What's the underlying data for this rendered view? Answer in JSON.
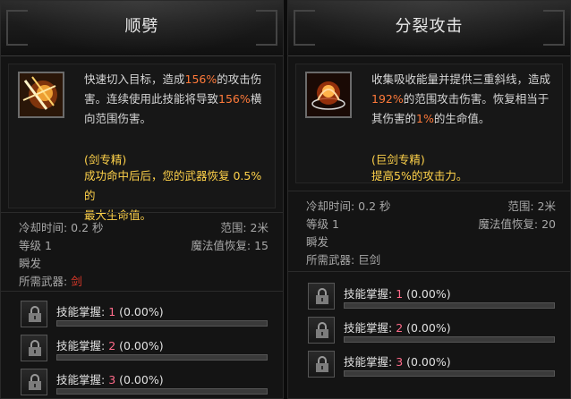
{
  "left": {
    "title": "顺劈",
    "desc_line1_pre": "快速切入目标，造成",
    "desc_line1_pct": "156%",
    "desc_line1_post": "的攻击伤",
    "desc_line2_pre": "害。连续使用此技能将导致",
    "desc_line2_pct": "156%",
    "desc_line2_post": "横",
    "desc_line3": "向范围伤害。",
    "spec_title": "(剑专精)",
    "spec_line1": "成功命中后后，您的武器恢复 0.5% 的",
    "spec_line2": "最大生命值。",
    "cooldown": "冷却时间: 0.2 秒",
    "range": "范围: 2米",
    "level": "等级 1",
    "mana": "魔法值恢复: 15",
    "cast": "瞬发",
    "weapon_label": "所需武器: ",
    "weapon_value": "剑"
  },
  "right": {
    "title": "分裂攻击",
    "desc_line1": "收集吸收能量并提供三重斜线，造成",
    "desc_line2_pct": "192%",
    "desc_line2_post": "的范围攻击伤害。恢复相当于",
    "desc_line3_pre": "其伤害的",
    "desc_line3_pct": "1%",
    "desc_line3_post": "的生命值。",
    "spec_title": "(巨剑专精)",
    "spec_line1": "提高5%的攻击力。",
    "cooldown": "冷却时间: 0.2 秒",
    "range": "范围: 2米",
    "level": "等级 1",
    "mana": "魔法值恢复: 20",
    "cast": "瞬发",
    "weapon": "所需武器: 巨剑"
  },
  "mastery": {
    "label": "技能掌握: ",
    "rows": [
      {
        "num": "1",
        "pct": " (0.00%)",
        "fill": 0
      },
      {
        "num": "2",
        "pct": " (0.00%)",
        "fill": 0
      },
      {
        "num": "3",
        "pct": " (0.00%)",
        "fill": 0
      }
    ]
  },
  "colors": {
    "highlight": "#ff7a3a",
    "spec": "#ffd24a",
    "weapon": "#e03a2a",
    "mastery_num": "#ff6b8a"
  }
}
